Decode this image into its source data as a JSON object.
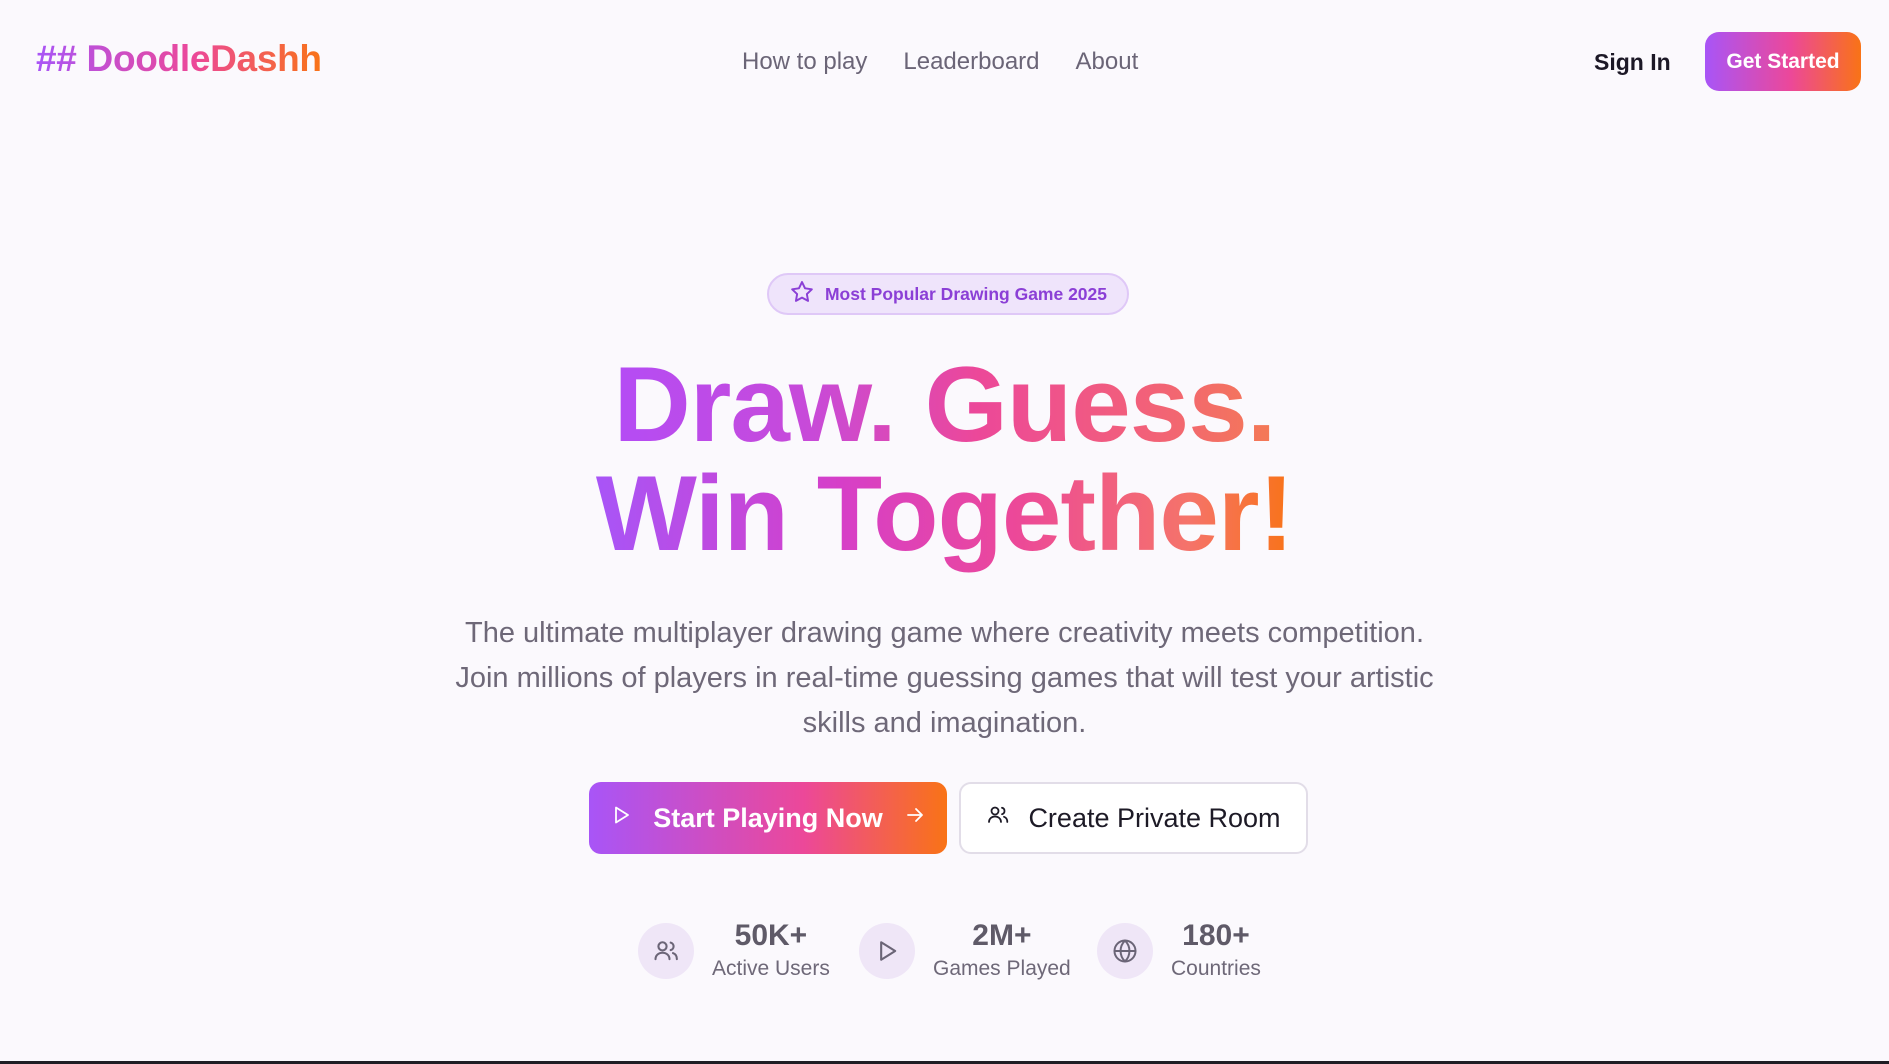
{
  "header": {
    "logo": "## DoodleDashh",
    "nav": [
      "How to play",
      "Leaderboard",
      "About"
    ],
    "sign_in": "Sign In",
    "get_started": "Get Started"
  },
  "hero": {
    "badge": "Most Popular Drawing Game 2025",
    "headline_line1": "Draw. Guess.",
    "headline_line2": "Win Together!",
    "description": "The ultimate multiplayer drawing game where creativity meets competition. Join millions of players in real-time guessing games that will test your artistic skills and imagination.",
    "primary_cta": "Start Playing Now",
    "secondary_cta": "Create Private Room"
  },
  "stats": [
    {
      "icon": "users-icon",
      "value": "50K+",
      "label": "Active Users"
    },
    {
      "icon": "play-icon",
      "value": "2M+",
      "label": "Games Played"
    },
    {
      "icon": "globe-icon",
      "value": "180+",
      "label": "Countries"
    }
  ],
  "colors": {
    "gradient_start": "#a855f7",
    "gradient_mid": "#ec4899",
    "gradient_end": "#f97316",
    "background": "#fbf9fd"
  }
}
